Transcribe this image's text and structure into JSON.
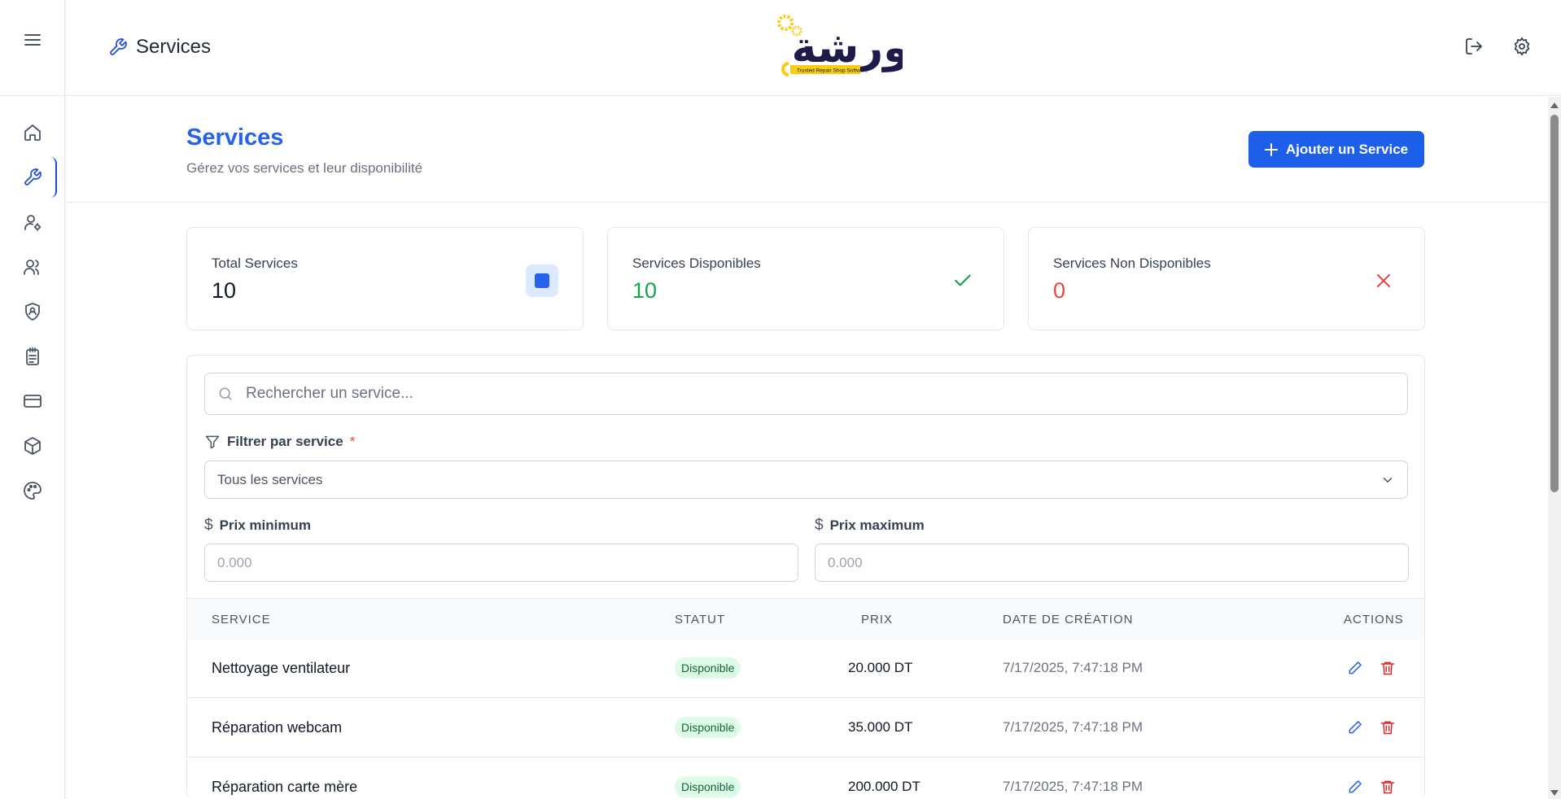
{
  "header": {
    "title": "Services",
    "logo_text": "ورشة",
    "logo_tagline": "Trusted Repair Shop Software"
  },
  "page": {
    "title": "Services",
    "subtitle": "Gérez vos services et leur disponibilité",
    "add_button": "Ajouter un Service"
  },
  "stats": [
    {
      "label": "Total Services",
      "value": "10",
      "color": "#111827"
    },
    {
      "label": "Services Disponibles",
      "value": "10",
      "color": "#16a34a"
    },
    {
      "label": "Services Non Disponibles",
      "value": "0",
      "color": "#ef4444"
    }
  ],
  "filters": {
    "search_placeholder": "Rechercher un service...",
    "service_filter_label": "Filtrer par service",
    "service_filter_required": "*",
    "service_filter_value": "Tous les services",
    "price_min_label": "Prix minimum",
    "price_min_placeholder": "0.000",
    "price_max_label": "Prix maximum",
    "price_max_placeholder": "0.000"
  },
  "table": {
    "headers": [
      "Service",
      "Statut",
      "Prix",
      "Date de création",
      "Actions"
    ],
    "rows": [
      {
        "service": "Nettoyage ventilateur",
        "status": "Disponible",
        "price": "20.000 DT",
        "date": "7/17/2025, 7:47:18 PM"
      },
      {
        "service": "Réparation webcam",
        "status": "Disponible",
        "price": "35.000 DT",
        "date": "7/17/2025, 7:47:18 PM"
      },
      {
        "service": "Réparation carte mère",
        "status": "Disponible",
        "price": "200.000 DT",
        "date": "7/17/2025, 7:47:18 PM"
      }
    ]
  },
  "colors": {
    "accent": "#2563eb",
    "success": "#16a34a",
    "danger": "#ef4444"
  }
}
